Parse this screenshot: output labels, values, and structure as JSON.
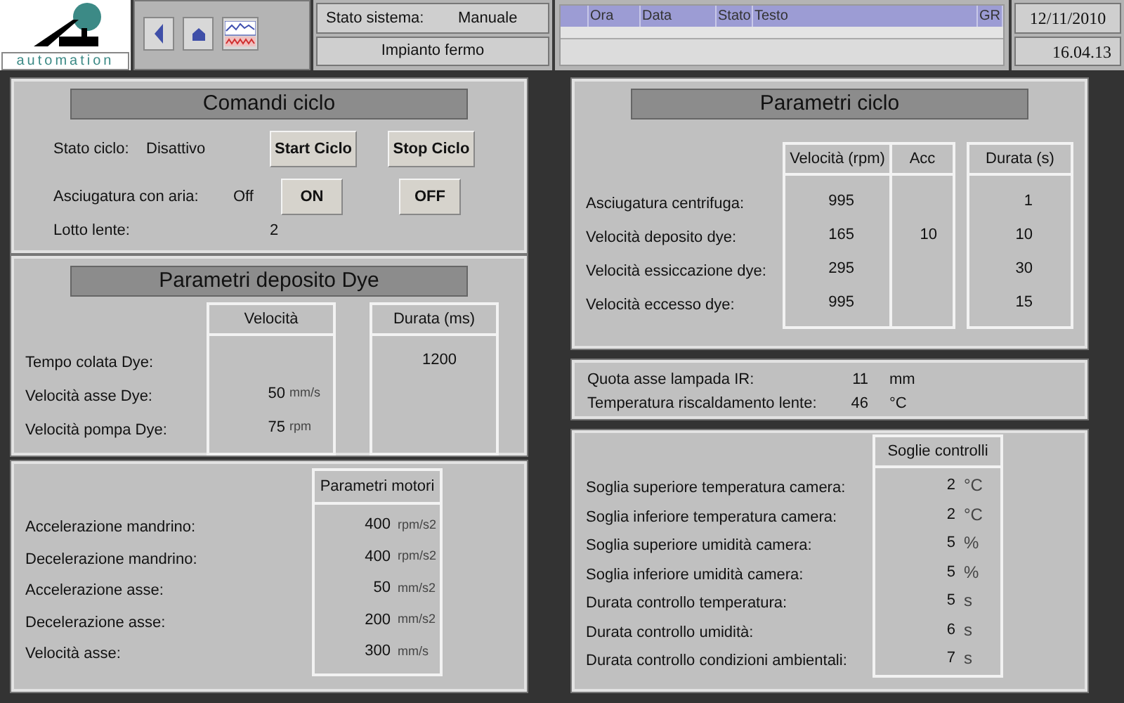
{
  "header": {
    "logo_text": "automation",
    "system_status_label": "Stato sistema:",
    "system_status_value": "Manuale",
    "plant_state": "Impianto fermo",
    "alarm_columns": [
      "Ora",
      "Data",
      "Stato",
      "Testo",
      "GR"
    ],
    "date": "12/11/2010",
    "time": "16.04.13"
  },
  "cycle_commands": {
    "title": "Comandi ciclo",
    "status_label": "Stato ciclo:",
    "status_value": "Disattivo",
    "start_button": "Start Ciclo",
    "stop_button": "Stop Ciclo",
    "air_dry_label": "Asciugatura con aria:",
    "air_dry_value": "Off",
    "on_button": "ON",
    "off_button": "OFF",
    "batch_label": "Lotto lente:",
    "batch_value": "2"
  },
  "dye_parameters": {
    "title": "Parametri deposito Dye",
    "columns": [
      "Velocità",
      "Durata (ms)"
    ],
    "rows": [
      {
        "label": "Tempo colata Dye:",
        "speed": "",
        "speed_unit": "",
        "duration": "1200"
      },
      {
        "label": "Velocità asse Dye:",
        "speed": "50",
        "speed_unit": "mm/s",
        "duration": ""
      },
      {
        "label": "Velocità pompa  Dye:",
        "speed": "75",
        "speed_unit": "rpm",
        "duration": ""
      }
    ]
  },
  "motor_parameters": {
    "column": "Parametri motori",
    "rows": [
      {
        "label": "Accelerazione mandrino:",
        "value": "400",
        "unit": "rpm/s2"
      },
      {
        "label": "Decelerazione mandrino:",
        "value": "400",
        "unit": "rpm/s2"
      },
      {
        "label": "Accelerazione asse:",
        "value": "50",
        "unit": "mm/s2"
      },
      {
        "label": "Decelerazione asse:",
        "value": "200",
        "unit": "mm/s2"
      },
      {
        "label": "Velocità asse:",
        "value": "300",
        "unit": "mm/s"
      }
    ]
  },
  "cycle_parameters": {
    "title": "Parametri ciclo",
    "columns": [
      "Velocità (rpm)",
      "Acc",
      "Durata (s)"
    ],
    "rows": [
      {
        "label": "Asciugatura centrifuga:",
        "speed": "995",
        "acc": "",
        "duration": "1"
      },
      {
        "label": "Velocità deposito dye:",
        "speed": "165",
        "acc": "10",
        "duration": "10"
      },
      {
        "label": "Velocità essiccazione dye:",
        "speed": "295",
        "acc": "",
        "duration": "30"
      },
      {
        "label": "Velocità eccesso dye:",
        "speed": "995",
        "acc": "",
        "duration": "15"
      }
    ]
  },
  "ir_lamp": {
    "rows": [
      {
        "label": "Quota asse lampada IR:",
        "value": "11",
        "unit": "mm"
      },
      {
        "label": "Temperatura riscaldamento lente:",
        "value": "46",
        "unit": "°C"
      }
    ]
  },
  "thresholds": {
    "column": "Soglie controlli",
    "rows": [
      {
        "label": "Soglia superiore temperatura camera:",
        "value": "2",
        "unit": "°C"
      },
      {
        "label": "Soglia inferiore temperatura camera:",
        "value": "2",
        "unit": "°C"
      },
      {
        "label": "Soglia superiore umidità camera:",
        "value": "5",
        "unit": "%"
      },
      {
        "label": "Soglia inferiore umidità camera:",
        "value": "5",
        "unit": "%"
      },
      {
        "label": "Durata controllo temperatura:",
        "value": "5",
        "unit": "s"
      },
      {
        "label": "Durata controllo umidità:",
        "value": "6",
        "unit": "s"
      },
      {
        "label": "Durata controllo condizioni ambientali:",
        "value": "7",
        "unit": "s"
      }
    ]
  }
}
